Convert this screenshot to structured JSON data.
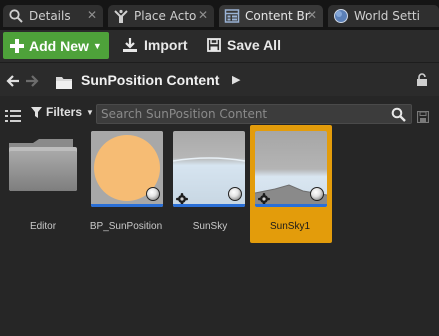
{
  "tabs": [
    {
      "label": "Details",
      "icon": "magnifier-icon",
      "active": false
    },
    {
      "label": "Place Acto",
      "icon": "place-actors-icon",
      "active": false
    },
    {
      "label": "Content Br",
      "icon": "content-browser-icon",
      "active": true
    },
    {
      "label": "World Setti",
      "icon": "globe-icon",
      "active": false
    }
  ],
  "toolbar": {
    "add_new_label": "Add New",
    "import_label": "Import",
    "save_all_label": "Save All"
  },
  "path": {
    "current_folder": "SunPosition Content"
  },
  "filters": {
    "label": "Filters",
    "search_placeholder": "Search SunPosition Content",
    "search_value": ""
  },
  "assets": [
    {
      "label": "Editor",
      "type": "folder",
      "selected": false
    },
    {
      "label": "BP_SunPosition",
      "type": "blueprint",
      "selected": false
    },
    {
      "label": "SunSky",
      "type": "level",
      "selected": false
    },
    {
      "label": "SunSky1",
      "type": "level",
      "selected": true
    }
  ],
  "colors": {
    "accent_green": "#4ea23a",
    "selection_orange": "#e39c0b",
    "asset_bar_blue": "#2a6fd6",
    "background": "#262626"
  }
}
